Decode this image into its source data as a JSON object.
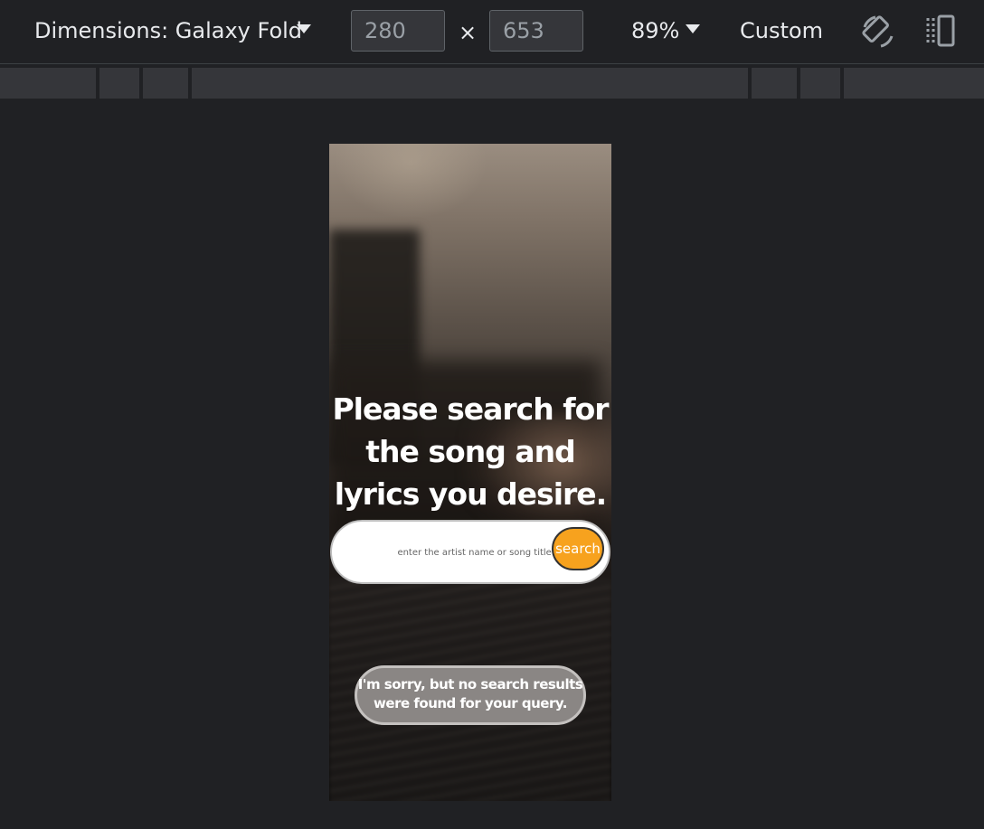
{
  "toolbar": {
    "dimensions_label": "Dimensions: Galaxy Fold",
    "width_value": "280",
    "height_value": "653",
    "times": "×",
    "zoom": "89%",
    "throttle": "Custom"
  },
  "page": {
    "headline": "Please search for the song and lyrics you desire.",
    "search_placeholder": "enter the artist name or song title.",
    "search_button": "search",
    "no_results": "I'm sorry, but no search results were found for your query."
  },
  "colors": {
    "search_button": "#f7a21e",
    "devtools_background": "#202124"
  }
}
